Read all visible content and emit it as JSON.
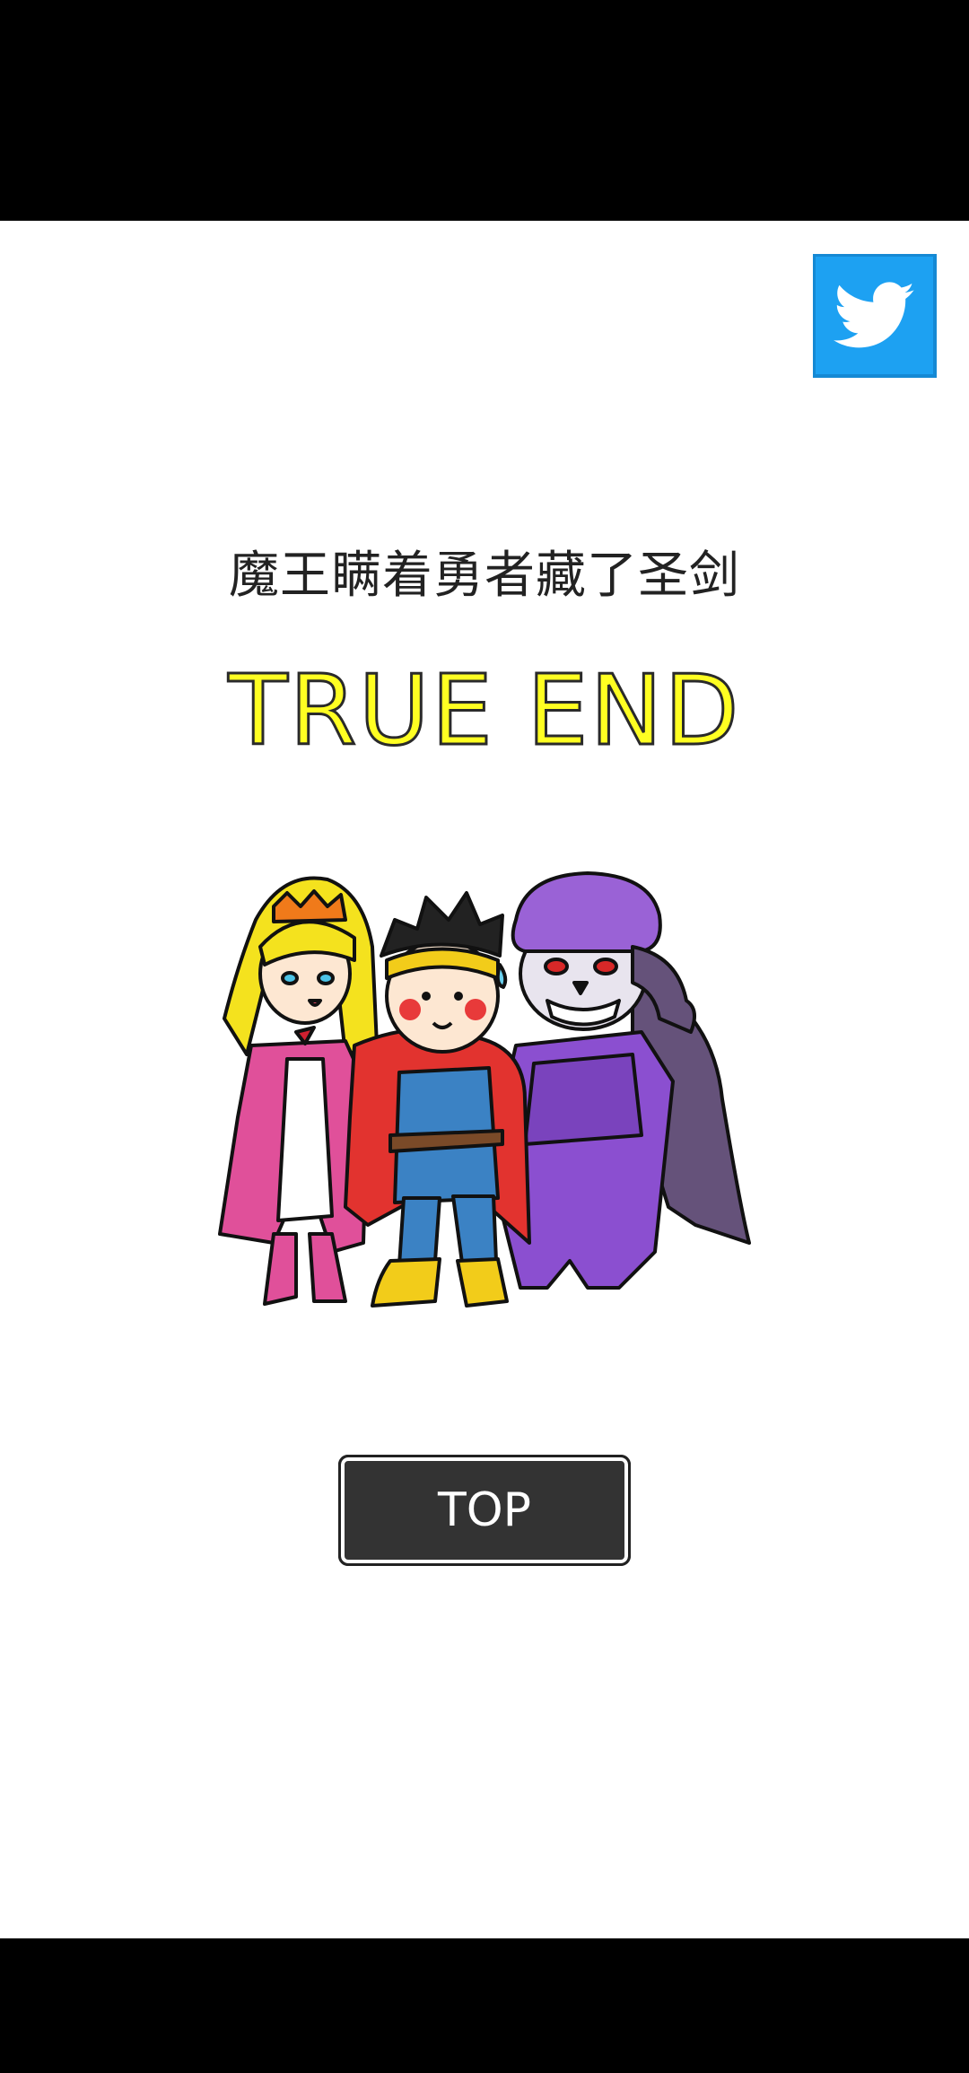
{
  "ending": {
    "title": "魔王瞒着勇者藏了圣剑",
    "type": "TRUE END"
  },
  "buttons": {
    "top_label": "TOP"
  },
  "share": {
    "icon": "twitter-bird-icon",
    "color": "#1da1f2"
  },
  "illustration": {
    "characters": [
      "princess",
      "hero",
      "demon-lord"
    ]
  },
  "colors": {
    "ending_type": "#ffff22",
    "button_bg": "#333333",
    "background": "#ffffff"
  }
}
